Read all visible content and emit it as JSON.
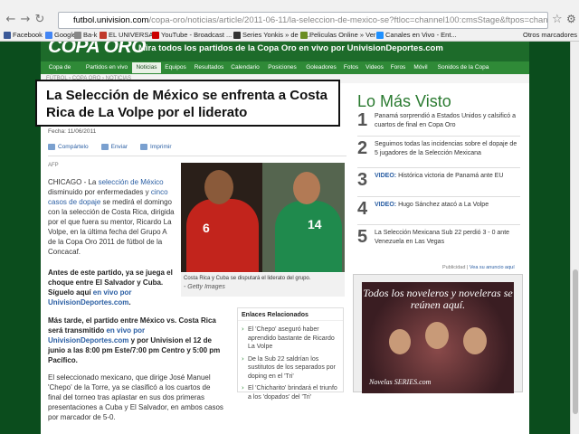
{
  "browser": {
    "url_host": "futbol.univision.com",
    "url_path": "/copa-oro/noticias/article/2011-06-11/la-seleccion-de-mexico-se?ftloc=channel100:cmsStage&ftpos=channel100:cmsStage:1",
    "bookmarks": [
      {
        "label": "Facebook",
        "color": "#3b5998"
      },
      {
        "label": "Google",
        "color": "#4285f4"
      },
      {
        "label": "Ba-k",
        "color": "#888888"
      },
      {
        "label": "EL UNIVERSAL",
        "color": "#c0392b"
      },
      {
        "label": "YouTube - Broadcast ...",
        "color": "#cc0000"
      },
      {
        "label": "Series Yonkis » de tel...",
        "color": "#333333"
      },
      {
        "label": "Peliculas Online » Ver ...",
        "color": "#6b8e23"
      },
      {
        "label": "Canales en Vivo - Ent...",
        "color": "#1e90ff"
      }
    ],
    "other_bookmarks": "Otros marcadores"
  },
  "site": {
    "logo": "COPA ORO",
    "tagline": "Mira todos los partidos de la Copa Oro en vivo por UnivisionDeportes.com",
    "menu": [
      "Copa de Oro",
      "Partidos en vivo",
      "Noticias",
      "Equipos",
      "Resultados",
      "Calendario",
      "Posiciones",
      "Goleadores",
      "Fotos",
      "Videos",
      "Foros",
      "Móvil",
      "Sonidos de la Copa"
    ],
    "active_menu": "Noticias",
    "subnav": "FÚTBOL › COPA ORO › NOTICIAS"
  },
  "article": {
    "headline": "La Selección de México se enfrenta a Costa Rica de La Volpe por el liderato",
    "date": "Fecha: 11/06/2011",
    "share": [
      "Compártelo",
      "Enviar",
      "Imprimir"
    ],
    "source": "AFP",
    "p1_city": "CHICAGO",
    "p1_a": " - La ",
    "p1_link1": "selección de México",
    "p1_b": " disminuido por enfermedades y ",
    "p1_link2": "cinco casos de dopaje",
    "p1_c": " se medirá el domingo con la selección de Costa Rica, dirigida por el que fuera su mentor, Ricardo La Volpe, en la última fecha del Grupo A de la Copa Oro 2011 de fútbol de la Concacaf.",
    "p2_a": "Antes de este partido, ya se juega el choque entre El Salvador y Cuba. Síguelo aquí ",
    "p2_link": "en vivo por UnivisionDeportes.com",
    "p2_b": ".",
    "p3_a": "Más tarde, el partido entre México vs. Costa Rica será transmitido ",
    "p3_link": "en vivo por UnivisionDeportes.com",
    "p3_b": " y por Univision el 12 de junio a las 8:00 pm Este/7:00 pm Centro y 5:00 pm Pacífico.",
    "p4": "El seleccionado mexicano, que dirige José Manuel 'Chepo' de la Torre, ya se clasificó a los cuartos de final del torneo tras aplastar en sus dos primeras presentaciones a Cuba y El Salvador, en ambos casos por marcador de 5-0.",
    "photo_num1": "6",
    "photo_num2": "14",
    "caption": "Costa Rica y Cuba se disputará el liderato del grupo.",
    "credit": "- Getty Images"
  },
  "related": {
    "title": "Enlaces Relacionados",
    "items": [
      "El 'Chepo' aseguró haber aprendido bastante de Ricardo La Volpe",
      "De la Sub 22 saldrían los sustitutos de los separados por doping en el 'Tri'",
      "El 'Chicharito' brindará el triunfo a los 'dopados' del 'Tri'"
    ]
  },
  "most_viewed": {
    "title": "Lo Más Visto",
    "items": [
      {
        "n": "1",
        "prefix": "",
        "text": "Panamá sorprendió a Estados Unidos y calsificó a cuartos de final en Copa Oro"
      },
      {
        "n": "2",
        "prefix": "",
        "text": "Seguimos todas las incidencias sobre el dopaje de 5 jugadores de la Selección Mexicana"
      },
      {
        "n": "3",
        "prefix": "VIDEO:",
        "text": " Histórica victoria de Panamá ante EU"
      },
      {
        "n": "4",
        "prefix": "VIDEO:",
        "text": " Hugo Sánchez atacó a La Volpe"
      },
      {
        "n": "5",
        "prefix": "",
        "text": "La Selección Mexicana Sub 22 perdió 3 - 0 ante Venezuela en Las Vegas"
      }
    ]
  },
  "ad": {
    "label": "Publicidad",
    "link": "Vea su anuncio aquí",
    "headline": "Todos los noveleros y noveleras se reúnen aquí.",
    "brand": "Novelas SERIES.com"
  }
}
